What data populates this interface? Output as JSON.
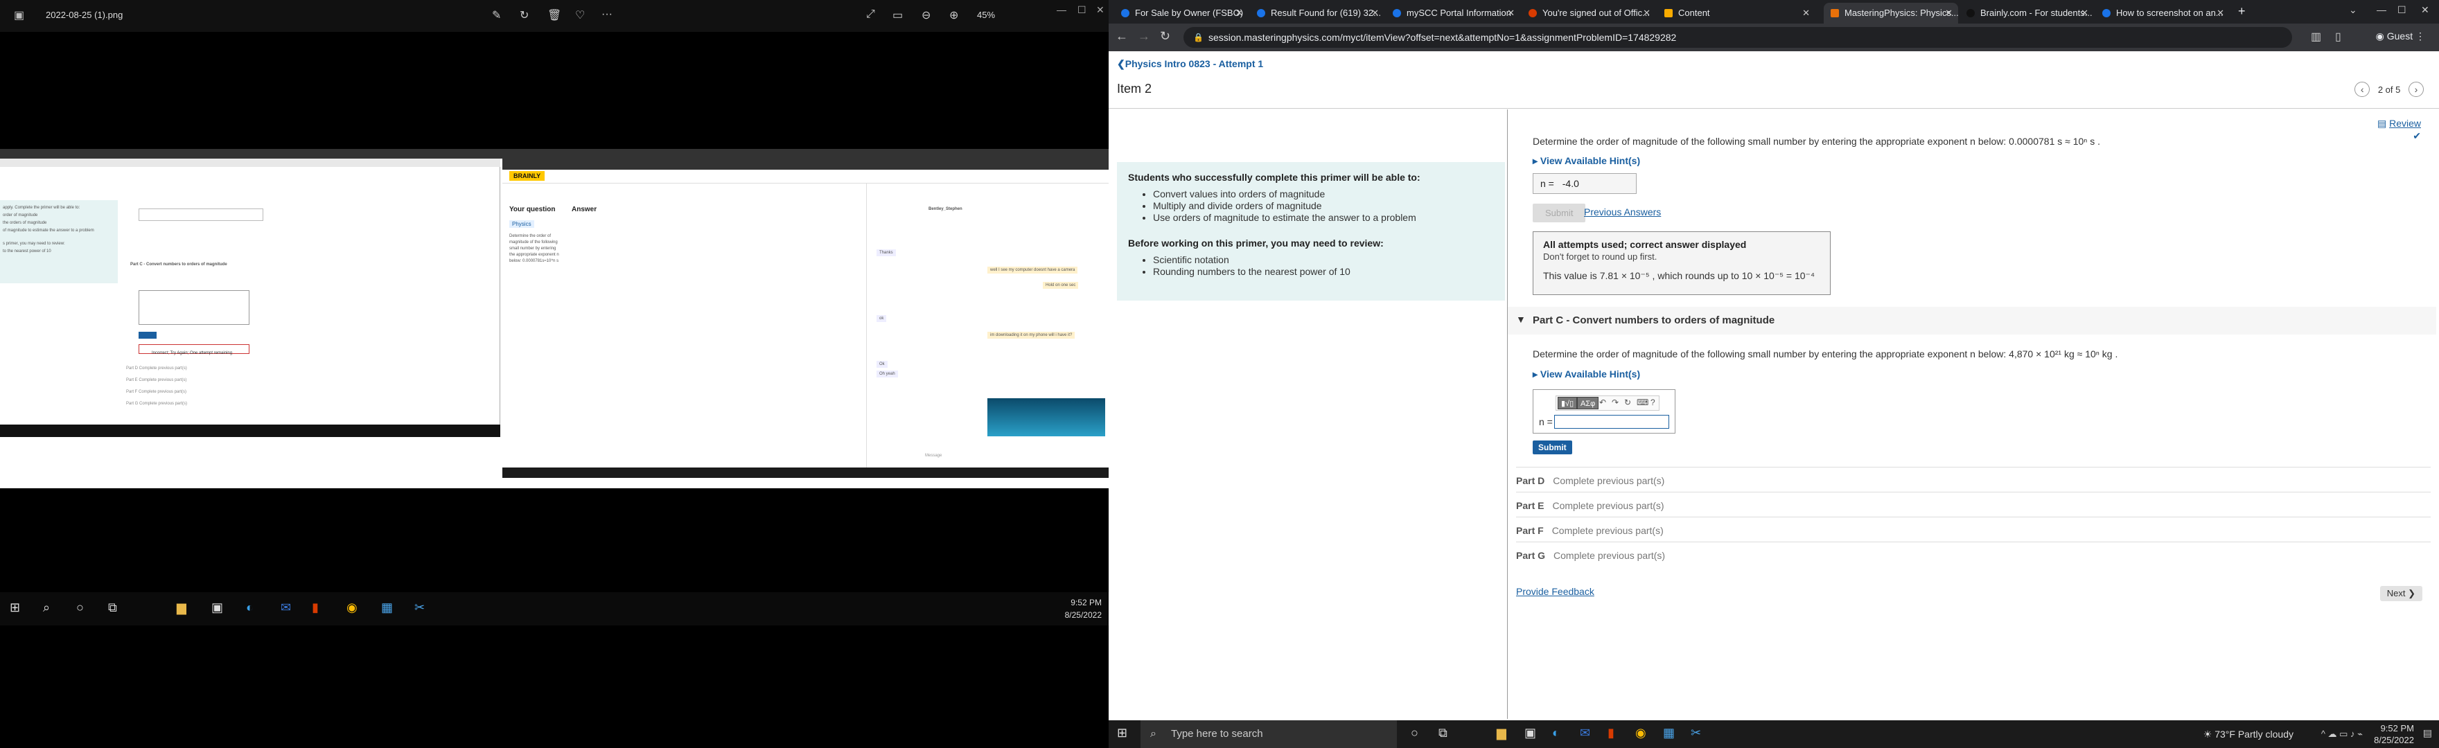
{
  "viewer": {
    "filename": "2022-08-25 (1).png",
    "zoom": "45%",
    "inner_left": {
      "lines": [
        "apply. Complete the primer will be able to:",
        "order of magnitude",
        "the orders of magnitude",
        "of magnitude to estimate the answer to a problem",
        "s primer, you may need to review:",
        "to the nearest power of 10"
      ],
      "part_c_label": "Part C - Convert numbers to orders of magnitude",
      "incorrect": "Incorrect; Try Again; One attempt remaining",
      "parts": [
        "Part D  Complete previous part(s)",
        "Part E  Complete previous part(s)",
        "Part F  Complete previous part(s)",
        "Part G  Complete previous part(s)"
      ]
    },
    "inner_right": {
      "brand": "BRAINLY",
      "your_question": "Your question",
      "subject": "Physics",
      "question_text": "Determine the order of magnitude of the following small number by entering the appropriate exponent n below: 0.0000781s≈10^n s",
      "answer_label": "Answer",
      "chat_user": "Bentley_Stephen",
      "chat_messages": [
        "Thanks",
        "well I see my computer doesnt have a camera",
        "Hold on one sec",
        "ok",
        "im downloading it on my phone will i have it?",
        "Ok",
        "Oh yeah"
      ],
      "message_placeholder": "Message"
    },
    "clock_time": "9:52 PM",
    "clock_date": "8/25/2022"
  },
  "browser": {
    "tabs": [
      "For Sale by Owner (FSBO)",
      "Result Found for (619) 32...",
      "mySCC Portal Information",
      "You're signed out of Offic...",
      "Content",
      "MasteringPhysics: Physics...",
      "Brainly.com - For students...",
      "How to screenshot on an..."
    ],
    "url": "session.masteringphysics.com/myct/itemView?offset=next&attemptNo=1&assignmentProblemID=174829282",
    "profile": "Guest"
  },
  "page": {
    "breadcrumb": "Physics Intro 0823 - Attempt 1",
    "item_title": "Item 2",
    "pager": "2 of 5",
    "review": "Review",
    "primer": {
      "heading1": "Students who successfully complete this primer will be able to:",
      "goals": [
        "Convert values into orders of magnitude",
        "Multiply and divide orders of magnitude",
        "Use orders of magnitude to estimate the answer to a problem"
      ],
      "heading2": "Before working on this primer, you may need to review:",
      "review_items": [
        "Scientific notation",
        "Rounding numbers to the nearest power of 10"
      ]
    },
    "part_b": {
      "prompt": "Determine the order of magnitude of the following small number by entering the appropriate exponent n below: 0.0000781 s ≈ 10ⁿ s .",
      "hint_link": "View Available Hint(s)",
      "n_label": "n =",
      "answer_value": "-4.0",
      "submit": "Submit",
      "previous_answers": "Previous Answers",
      "feedback_title": "All attempts used; correct answer displayed",
      "feedback_sub": "Don't forget to round up first.",
      "feedback_value": "This value is 7.81 × 10⁻⁵ , which rounds up to 10 × 10⁻⁵ = 10⁻⁴"
    },
    "part_c": {
      "label": "Part C - Convert numbers to orders of magnitude",
      "prompt": "Determine the order of magnitude of the following small number by entering the appropriate exponent n below: 4,870 × 10²¹ kg ≈ 10ⁿ kg .",
      "hint_link": "View Available Hint(s)",
      "n_label": "n =",
      "input_value": "",
      "submit": "Submit",
      "tool_labels": [
        "▮√▯",
        "ΑΣφ",
        "↶",
        "↷",
        "↻",
        "⌨",
        "?"
      ]
    },
    "parts_remaining": [
      {
        "part": "Part D",
        "status": "Complete previous part(s)"
      },
      {
        "part": "Part E",
        "status": "Complete previous part(s)"
      },
      {
        "part": "Part F",
        "status": "Complete previous part(s)"
      },
      {
        "part": "Part G",
        "status": "Complete previous part(s)"
      }
    ],
    "provide_feedback": "Provide Feedback",
    "next": "Next ❯"
  },
  "taskbar": {
    "search_placeholder": "Type here to search",
    "weather": "73°F Partly cloudy",
    "time": "9:52 PM",
    "date": "8/25/2022"
  }
}
